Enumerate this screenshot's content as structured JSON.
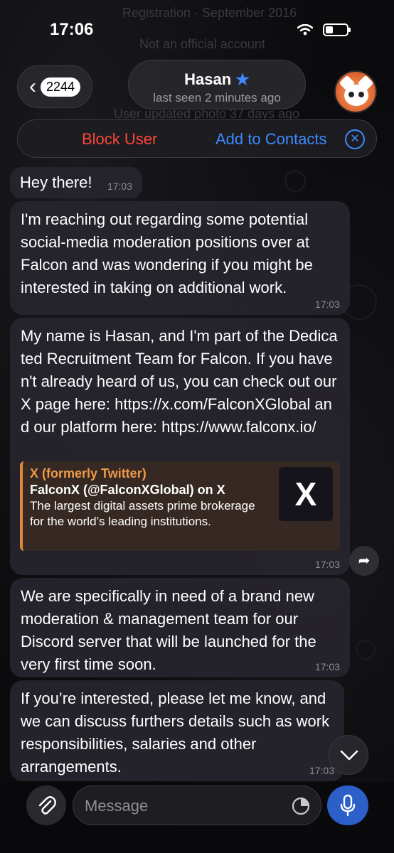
{
  "status_bar": {
    "time": "17:06"
  },
  "background_hints": {
    "registration": "Registration · September 2016",
    "official": "Not an official account",
    "updated": "User updated photo 37 days ago"
  },
  "header": {
    "back_count": "2244",
    "name": "Hasan",
    "last_seen": "last seen 2 minutes ago"
  },
  "action_bar": {
    "block_label": "Block User",
    "add_label": "Add to Contacts"
  },
  "messages": [
    {
      "text": "Hey there!",
      "time": "17:03"
    },
    {
      "text": "I'm reaching out regarding some potential social-media moderation positions over at Falcon and was wondering if you might be interested in taking on additional work.",
      "time": "17:03"
    },
    {
      "text": "My name is Hasan, and I'm part of the Dedicated Recruitment Team for Falcon. If you haven't already heard of us, you can check out our X page here: https://x.com/FalconXGlobal and our platform here: https://www.falconx.io/",
      "time": "17:03"
    },
    {
      "text": "We are specifically in need of a brand new moderation & management team for our Discord server that will be launched for the very first time soon.",
      "time": "17:03"
    },
    {
      "text": "If you’re interested, please let me know, and we can discuss furthers details such as work responsibilities, salaries and other arrangements.",
      "time": "17:03"
    }
  ],
  "link_preview": {
    "site": "X (formerly Twitter)",
    "title": "FalconX (@FalconXGlobal) on X",
    "description": "The largest digital assets prime brokerage for the world’s leading institutions.",
    "thumb": "X"
  },
  "input": {
    "placeholder": "Message"
  },
  "colors": {
    "accent": "#3d8bff",
    "danger": "#ff453a",
    "link_bar": "#e0893a"
  }
}
